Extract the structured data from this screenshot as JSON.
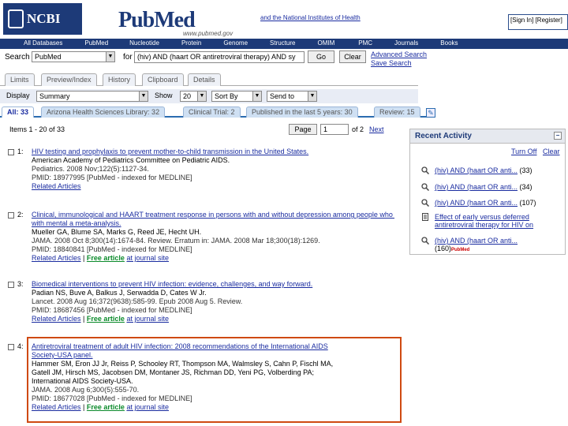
{
  "header": {
    "ncbi_logo": "NCBI",
    "pubmed_logo": "PubMed",
    "pubmed_url": "www.pubmed.gov",
    "nih_text": "and the National Institutes of Health",
    "sign_in": "[Sign In] [Register]"
  },
  "nav": [
    "All Databases",
    "PubMed",
    "Nucleotide",
    "Protein",
    "Genome",
    "Structure",
    "OMIM",
    "PMC",
    "Journals",
    "Books"
  ],
  "search": {
    "label": "Search",
    "db_value": "PubMed",
    "for_label": "for",
    "query": "(hiv) AND (haart OR antiretroviral therapy) AND sy",
    "go": "Go",
    "clear": "Clear",
    "advanced": "Advanced Search",
    "save": "Save Search"
  },
  "tabs": [
    "Limits",
    "Preview/Index",
    "History",
    "Clipboard",
    "Details"
  ],
  "display": {
    "display_label": "Display",
    "display_value": "Summary",
    "show_label": "Show",
    "show_value": "20",
    "sort_value": "Sort By",
    "send_value": "Send to"
  },
  "filter_tabs": [
    "All: 33",
    "Arizona Health Sciences Library: 32",
    "Clinical Trial: 2",
    "Published in the last 5 years: 30",
    "Review: 15"
  ],
  "paging": {
    "items": "Items 1 - 20 of 33",
    "page_btn": "Page",
    "page_value": "1",
    "of": "of 2",
    "next": "Next"
  },
  "results": [
    {
      "num": "1:",
      "title": "HIV testing and prophylaxis to prevent mother-to-child transmission in the United States.",
      "authors": "American Academy of Pediatrics Committee on Pediatric AIDS.",
      "source": "Pediatrics. 2008 Nov;122(5):1127-34.",
      "pmid": "PMID: 18977995 [PubMed - indexed for MEDLINE]",
      "links": "Related Articles",
      "free": ""
    },
    {
      "num": "2:",
      "title": "Clinical, immunological and HAART treatment response in persons with and without depression among people who have serious",
      "title2": "with mental a meta-analysis.",
      "authors": "Mueller GA, Blume SA, Marks G, Reed JE, Hecht UH.",
      "source": "JAMA. 2008 Oct 8;300(14):1674-84. Review. Erratum in: JAMA. 2008 Mar 18;300(18):1269.",
      "pmid": "PMID: 18840841 [PubMed - indexed for MEDLINE]",
      "links": "Related Articles",
      "free": "Free article",
      "more": "at journal site"
    },
    {
      "num": "3:",
      "title": "Biomedical interventions to prevent HIV infection: evidence, challenges, and way forward.",
      "authors": "Padian NS, Buve A, Balkus J, Serwadda D, Cates W Jr.",
      "source": "Lancet. 2008 Aug 16;372(9638):585-99. Epub 2008 Aug 5. Review.",
      "pmid": "PMID: 18687456 [PubMed - indexed for MEDLINE]",
      "links": "Related Articles",
      "free": "Free article",
      "more": "at journal site"
    },
    {
      "num": "4:",
      "title": "Antiretroviral treatment of adult HIV infection: 2008 recommendations of the International AIDS",
      "title2": "Society-USA panel.",
      "authors": "Hammer SM, Eron JJ Jr, Reiss P, Schooley RT, Thompson MA, Walmsley S, Cahn P, Fischl MA,",
      "authors2": "Gatell JM, Hirsch MS, Jacobsen DM, Montaner JS, Richman DD, Yeni PG, Volberding PA;",
      "authors3": "International AIDS Society-USA.",
      "source": "JAMA. 2008 Aug 6;300(5):555-70.",
      "pmid": "PMID: 18677028 [PubMed - indexed for MEDLINE]",
      "links": "Related Articles",
      "free": "Free article",
      "more": "at journal site"
    }
  ],
  "recent": {
    "title": "Recent Activity",
    "turn_off": "Turn Off",
    "clear": "Clear",
    "items": [
      {
        "text": "(hiv) AND (haart OR anti...",
        "count": "(33)"
      },
      {
        "text": "(hiv) AND (haart OR anti...",
        "count": "(34)"
      },
      {
        "text": "(hiv) AND (haart OR anti...",
        "count": "(107)"
      },
      {
        "text": "Effect of early versus deferred antiretroviral therapy for HIV on",
        "count": ""
      },
      {
        "text": "(hiv) AND (haart OR anti...",
        "count": "(160)"
      }
    ],
    "pubmed_tag": "PubMed"
  },
  "colors": {
    "nav_bg": "#1d3a78",
    "highlight": "#cf4a12",
    "link": "#1a2ca0"
  }
}
